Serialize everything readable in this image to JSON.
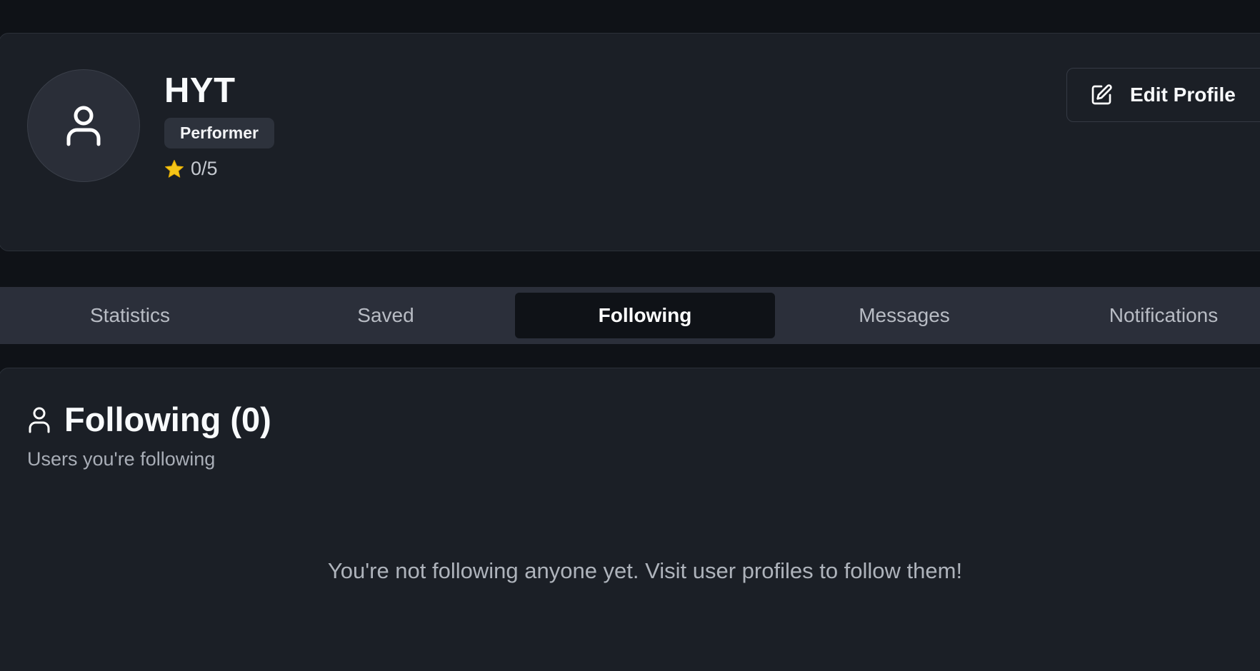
{
  "profile": {
    "name": "HYT",
    "role": "Performer",
    "rating": "0/5",
    "edit_label": "Edit Profile"
  },
  "tabs": [
    {
      "label": "Statistics",
      "active": false
    },
    {
      "label": "Saved",
      "active": false
    },
    {
      "label": "Following",
      "active": true
    },
    {
      "label": "Messages",
      "active": false
    },
    {
      "label": "Notifications",
      "active": false
    }
  ],
  "following": {
    "title": "Following (0)",
    "subtitle": "Users you're following",
    "empty_message": "You're not following anyone yet. Visit user profiles to follow them!"
  },
  "icons": {
    "avatar": "user-icon",
    "rating": "star-icon",
    "edit": "edit-icon",
    "section": "user-icon"
  },
  "colors": {
    "background": "#0f1217",
    "card": "#1b1f26",
    "tab_bar": "#2b2f3a",
    "active_tab": "#0f1217",
    "star": "#f5c518"
  }
}
